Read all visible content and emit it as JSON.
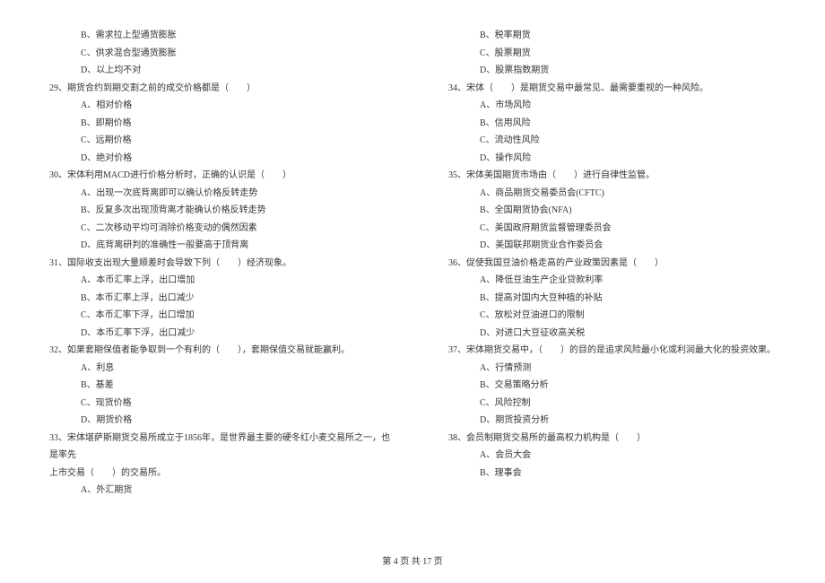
{
  "left_column": {
    "pre_options": [
      "B、需求拉上型通货膨胀",
      "C、供求混合型通货膨胀",
      "D、以上均不对"
    ],
    "q29": {
      "text": "29、期货合约到期交割之前的成交价格都是（　　）",
      "options": [
        "A、相对价格",
        "B、即期价格",
        "C、远期价格",
        "D、绝对价格"
      ]
    },
    "q30": {
      "text": "30、宋体利用MACD进行价格分析时，正确的认识是（　　）",
      "options": [
        "A、出现一次底背离即可以确认价格反转走势",
        "B、反复多次出现顶背离才能确认价格反转走势",
        "C、二次移动平均可消除价格变动的偶然因素",
        "D、底背离研判的准确性一般要高于顶背离"
      ]
    },
    "q31": {
      "text": "31、国际收支出现大量顺差时会导致下列（　　）经济现象。",
      "options": [
        "A、本币汇率上浮，出口增加",
        "B、本币汇率上浮，出口减少",
        "C、本币汇率下浮，出口增加",
        "D、本币汇率下浮，出口减少"
      ]
    },
    "q32": {
      "text": "32、如果套期保值者能争取到一个有利的（　　），套期保值交易就能赢利。",
      "options": [
        "A、利息",
        "B、基差",
        "C、现货价格",
        "D、期货价格"
      ]
    },
    "q33": {
      "text_line1": "33、宋体堪萨斯期货交易所成立于1856年，是世界最主要的硬冬红小麦交易所之一，也是率先",
      "text_line2": "上市交易（　　）的交易所。",
      "options": [
        "A、外汇期货"
      ]
    }
  },
  "right_column": {
    "pre_options": [
      "B、税率期货",
      "C、股票期货",
      "D、股票指数期货"
    ],
    "q34": {
      "text": "34、宋体（　　）是期货交易中最常见、最需要重视的一种风险。",
      "options": [
        "A、市场风险",
        "B、信用风险",
        "C、流动性风险",
        "D、操作风险"
      ]
    },
    "q35": {
      "text": "35、宋体美国期货市场由（　　）进行自律性监管。",
      "options": [
        "A、商品期货交易委员会(CFTC)",
        "B、全国期货协会(NFA)",
        "C、美国政府期货监督管理委员会",
        "D、美国联邦期货业合作委员会"
      ]
    },
    "q36": {
      "text": "36、促使我国豆油价格走高的产业政策因素是（　　）",
      "options": [
        "A、降低豆油生产企业贷款利率",
        "B、提高对国内大豆种植的补贴",
        "C、放松对豆油进口的限制",
        "D、对进口大豆征收高关税"
      ]
    },
    "q37": {
      "text": "37、宋体期货交易中，（　　）的目的是追求风险最小化或利润最大化的投资效果。",
      "options": [
        "A、行情预测",
        "B、交易策略分析",
        "C、风险控制",
        "D、期货投资分析"
      ]
    },
    "q38": {
      "text": "38、会员制期货交易所的最高权力机构是（　　）",
      "options": [
        "A、会员大会",
        "B、理事会"
      ]
    }
  },
  "footer": "第 4 页 共 17 页"
}
